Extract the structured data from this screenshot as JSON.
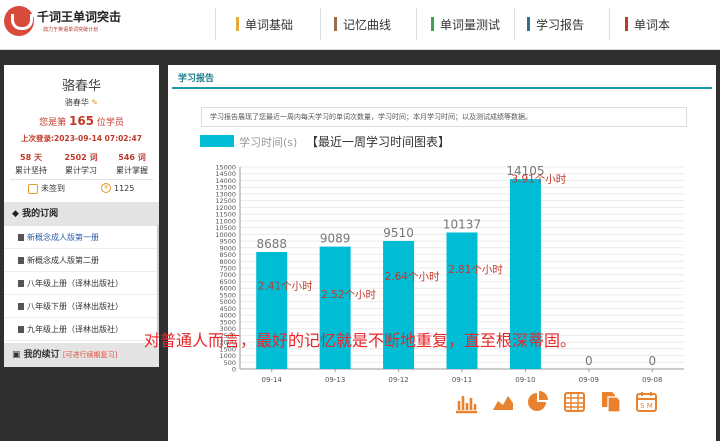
{
  "brand": {
    "title": "千词王单词突击",
    "subtitle": "· 鼎力于英语单词突破计划 ·"
  },
  "nav": [
    {
      "label": "单词基础",
      "color": "#e8a73a"
    },
    {
      "label": "记忆曲线",
      "color": "#9b6b4f"
    },
    {
      "label": "单词量测试",
      "color": "#3aa653"
    },
    {
      "label": "学习报告",
      "color": "#2f6f8f"
    },
    {
      "label": "单词本",
      "color": "#c0392b"
    }
  ],
  "user": {
    "name": "骆春华",
    "name_small": "骆春华",
    "rank_prefix": "您是第",
    "rank_value": "165",
    "rank_suffix": "位学员",
    "last_login": "上次登录:2023-09-14 07:02:47",
    "stats": [
      {
        "value": "58 天",
        "label": "累计坚持"
      },
      {
        "value": "2502 词",
        "label": "累计学习"
      },
      {
        "value": "546 词",
        "label": "累计掌握"
      }
    ],
    "signin": "未签到",
    "coins": "1125"
  },
  "subscriptions": {
    "header": "我的订阅",
    "books": [
      "新概念成人版第一册",
      "新概念成人版第二册",
      "八年级上册（译林出版社）",
      "八年级下册（译林出版社）",
      "九年级上册（译林出版社）"
    ]
  },
  "review": {
    "label": "我的续订",
    "note": "[可进行续期复习]"
  },
  "report": {
    "tab": "学习报告",
    "description": "学习报告展现了您最近一周内每天学习的单词次数量，学习时间；本月学习时间；以及测试成绩等数据。",
    "legend": "学习时间(s)",
    "title": "【最近一周学习时间图表】"
  },
  "chart_data": {
    "type": "bar",
    "categories": [
      "09-14",
      "09-13",
      "09-12",
      "09-11",
      "09-10",
      "09-09",
      "09-08"
    ],
    "values": [
      8688,
      9089,
      9510,
      10137,
      14105,
      0,
      0
    ],
    "hour_labels": [
      "2.41个小时",
      "2.52个小时",
      "2.64个小时",
      "2.81个小时",
      "3.91个小时",
      "",
      ""
    ],
    "ylim": [
      0,
      15000
    ],
    "yticks": [
      0,
      500,
      1000,
      1500,
      2000,
      2500,
      3000,
      3500,
      4000,
      4500,
      5000,
      5500,
      6000,
      6500,
      7000,
      7500,
      8000,
      8500,
      9000,
      9500,
      10000,
      10500,
      11000,
      11500,
      12000,
      12500,
      13000,
      13500,
      14000,
      14500,
      15000
    ],
    "bar_color": "#00bcd4",
    "grid": true
  },
  "toolbar_icons": [
    "bar-chart-icon",
    "area-chart-icon",
    "pie-chart-icon",
    "table-icon",
    "copy-icon",
    "calendar-icon"
  ],
  "overlay": "对普通人而言，最好的记忆就是不断地重复，直至根深蒂固。"
}
